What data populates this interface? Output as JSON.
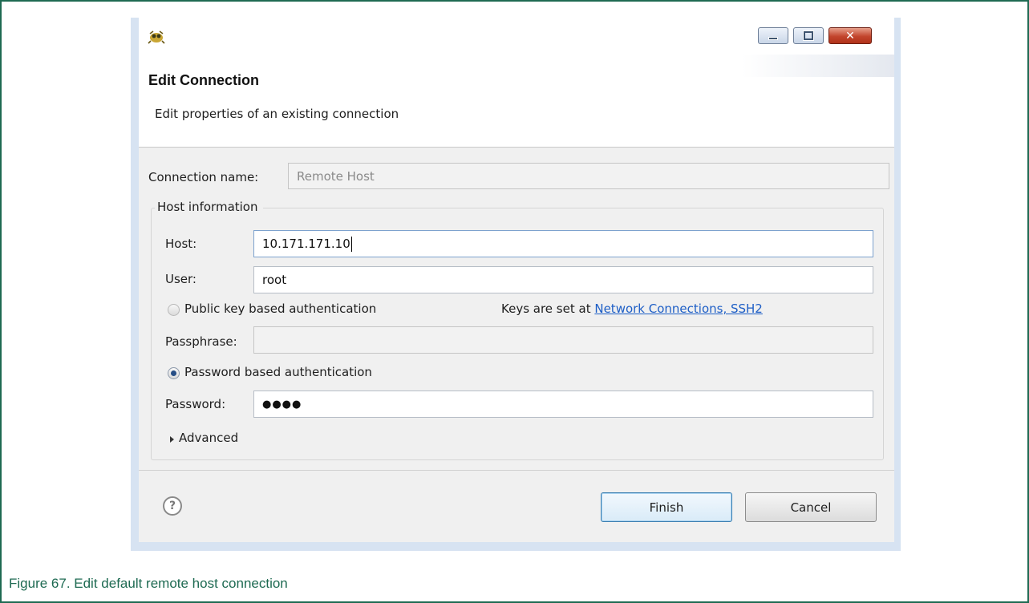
{
  "window": {
    "icon": "eclipse-app-icon",
    "minimize_icon": "minimize-icon",
    "maximize_icon": "maximize-icon",
    "close_symbol": "✕"
  },
  "header": {
    "title": "Edit Connection",
    "subtitle": "Edit properties of an existing connection"
  },
  "connection": {
    "name_label": "Connection name:",
    "name_value": "Remote Host"
  },
  "host_info": {
    "group_label": "Host information",
    "host_label": "Host:",
    "host_value": "10.171.171.10",
    "user_label": "User:",
    "user_value": "root",
    "pubkey_option": "Public key based authentication",
    "pubkey_selected": false,
    "keys_text": "Keys are set at",
    "keys_link": "Network Connections, SSH2",
    "passphrase_label": "Passphrase:",
    "passphrase_value": "",
    "password_option": "Password based authentication",
    "password_selected": true,
    "password_label": "Password:",
    "password_value": "●●●●",
    "advanced_label": "Advanced"
  },
  "footer": {
    "help_symbol": "?",
    "finish_label": "Finish",
    "cancel_label": "Cancel"
  },
  "caption": "Figure 67. Edit default remote host connection",
  "colors": {
    "frame_border": "#1e6a52",
    "caption_text": "#1e6a52",
    "link": "#1d5ec6",
    "dialog_outer": "#d7e3f2",
    "dialog_body": "#f0f0f0",
    "close_button": "#c2452d"
  }
}
